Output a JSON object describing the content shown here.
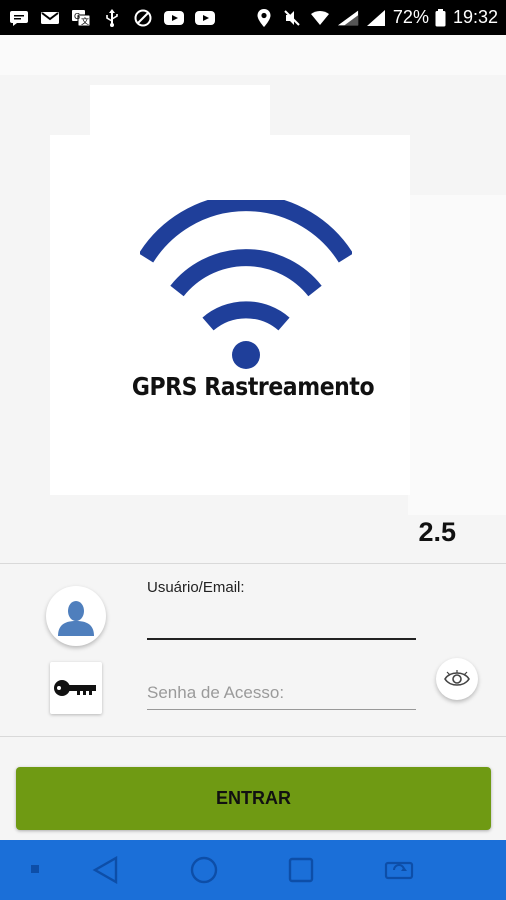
{
  "status_bar": {
    "battery": "72%",
    "time": "19:32",
    "icons": [
      "message-icon",
      "gmail-icon",
      "translate-icon",
      "usb-icon",
      "shield-icon",
      "youtube-icon",
      "youtube-icon",
      "location-icon",
      "mute-icon",
      "wifi-icon",
      "signal-icon",
      "signal-icon",
      "battery-icon"
    ]
  },
  "logo": {
    "title": "GPRS Rastreamento",
    "icon": "wifi-icon",
    "color": "#1f3f9a"
  },
  "version": "2.5",
  "login": {
    "user_label": "Usuário/Email:",
    "user_value": "",
    "password_placeholder": "Senha de Acesso:",
    "password_value": "",
    "user_icon": "user-icon",
    "key_icon": "key-icon",
    "eye_icon": "eye-icon"
  },
  "enter_button": {
    "label": "ENTRAR",
    "color": "#6f9a13"
  },
  "nav_bar": {
    "color": "#1b6fd8",
    "items": [
      "dot-icon",
      "back-icon",
      "home-icon",
      "recents-icon",
      "rotate-icon"
    ]
  }
}
